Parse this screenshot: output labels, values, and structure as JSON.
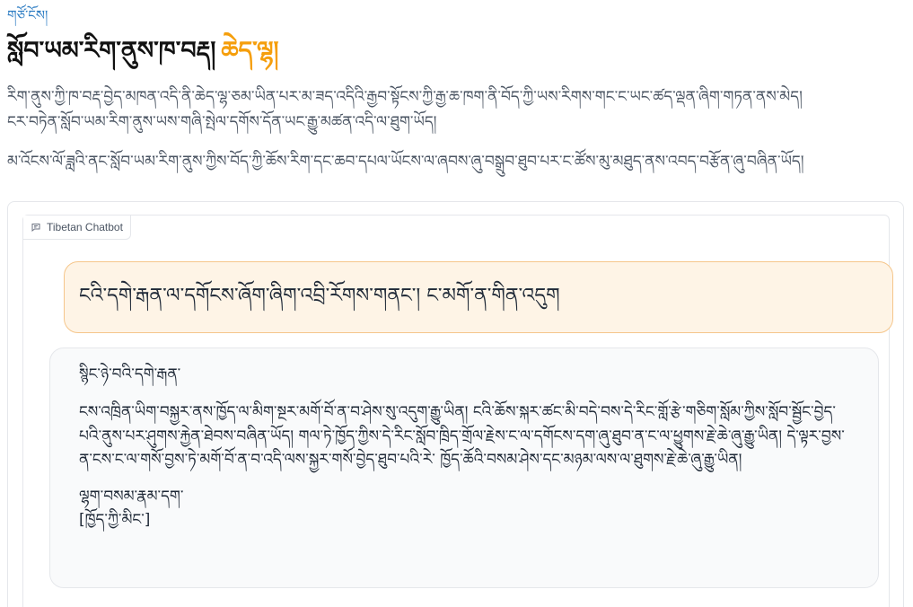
{
  "top_link": "གཙོ་ངོས།",
  "title": {
    "main": "སློབ་ཡམ་རིག་ནུས་ཁ་བརྡ།",
    "accent": "ཆེད་ལྷ།"
  },
  "description": {
    "line1": "རིག་ནུས་ཀྱི་ཁ་བརྡ་བྱེད་མཁན་འདི་ནི་ཆེད་ལྷ་ཅམ་ཡིན་པར་མ་ཟད་འདིའི་རྒྱབ་སྟོངས་ཀྱི་རྒྱ་ཆ་ཁག་ནི་བོད་ཀྱི་ཡས་རིགས་གང་ང་ཡང་ཚད་ལྡན་ཞིག་གཏན་ནས་མེད།",
    "line2": "ངར་བཏེན་སློབ་ཡམ་རིག་ནུས་ཡས་གཞི་སྤེལ་དགོས་དོན་ཡང་རྒྱུ་མཚན་འདི་ལ་ཐུག་ཡོད།",
    "line3": "མ་འོངས་ལོ་ཟླའི་ནང་སློབ་ཡམ་རིག་ནུས་ཀྱིས་བོད་ཀྱི་ཆོས་རིག་དང་ཆབ་དཔལ་ཡོངས་ལ་ཞབས་ཞུ་བསྒྲུབ་ཐུབ་པར་ང་ཚོས་མུ་མཐུད་ནས་འབད་བརྩོན་ཞུ་བཞིན་ཡོད།"
  },
  "chat": {
    "label": "Tibetan Chatbot",
    "label_icon": "chat-bubble-icon",
    "user_message": "ངའི་དགེ་རྒན་ལ་དགོངས་ཞོག་ཞིག་འབྲི་རོགས་གནང་། ང་མགོ་ན་གིན་འདུག",
    "bot_greeting": "སྙིང་ཉེ་བའི་དགེ་རྒན་",
    "bot_body": "ངས་འཁྲིན་ཡིག་བསྐྱར་ནས་ཁྱོད་ལ་མིག་སྔར་མགོ་བོ་ན་བ་ཤེས་སུ་འདུག་རྒྱུ་ཡིན། ངའི་ཆོས་སྐར་ཚང་མི་བདེ་བས་དེ་རིང་གློ་རྩེ་གཅིག་སློམ་ཀྱིས་སློབ་སྦྱོང་བྱེད་པའི་ནུས་པར་ཤུགས་རྐྱེན་ཐེབས་བཞིན་ཡོད། གལ་ཏེ་ཁྱོད་ཀྱིས་དེ་རིང་སློབ་ཁྲིད་གྲོལ་རྗེས་ང་ལ་དགོངས་དག་ཞུ་ཐུབ་ན་ང་ལ་ཕྱུགས་རྗེ་ཆེ་ཞུ་རྒྱུ་ཡིན། དེ་ལྟར་བྱས་ན་ངས་ང་ལ་གསོ་བྱས་ཏེ་མགོ་བོ་ན་བ་འདི་ལས་སྐྱར་གསོ་བྱེད་ཐུབ་པའི་རེ་ ཁྱོད་ཆོའི་བསམ་ཤེས་དང་མཉམ་ལས་ལ་ཐུགས་རྗེ་ཆེ་ཞུ་རྒྱུ་ཡིན།",
    "bot_closing_1": "ལྷག་བསམ་རྣམ་དག་",
    "bot_closing_2": "[ཁྱོད་ཀྱི་མིང་]"
  }
}
